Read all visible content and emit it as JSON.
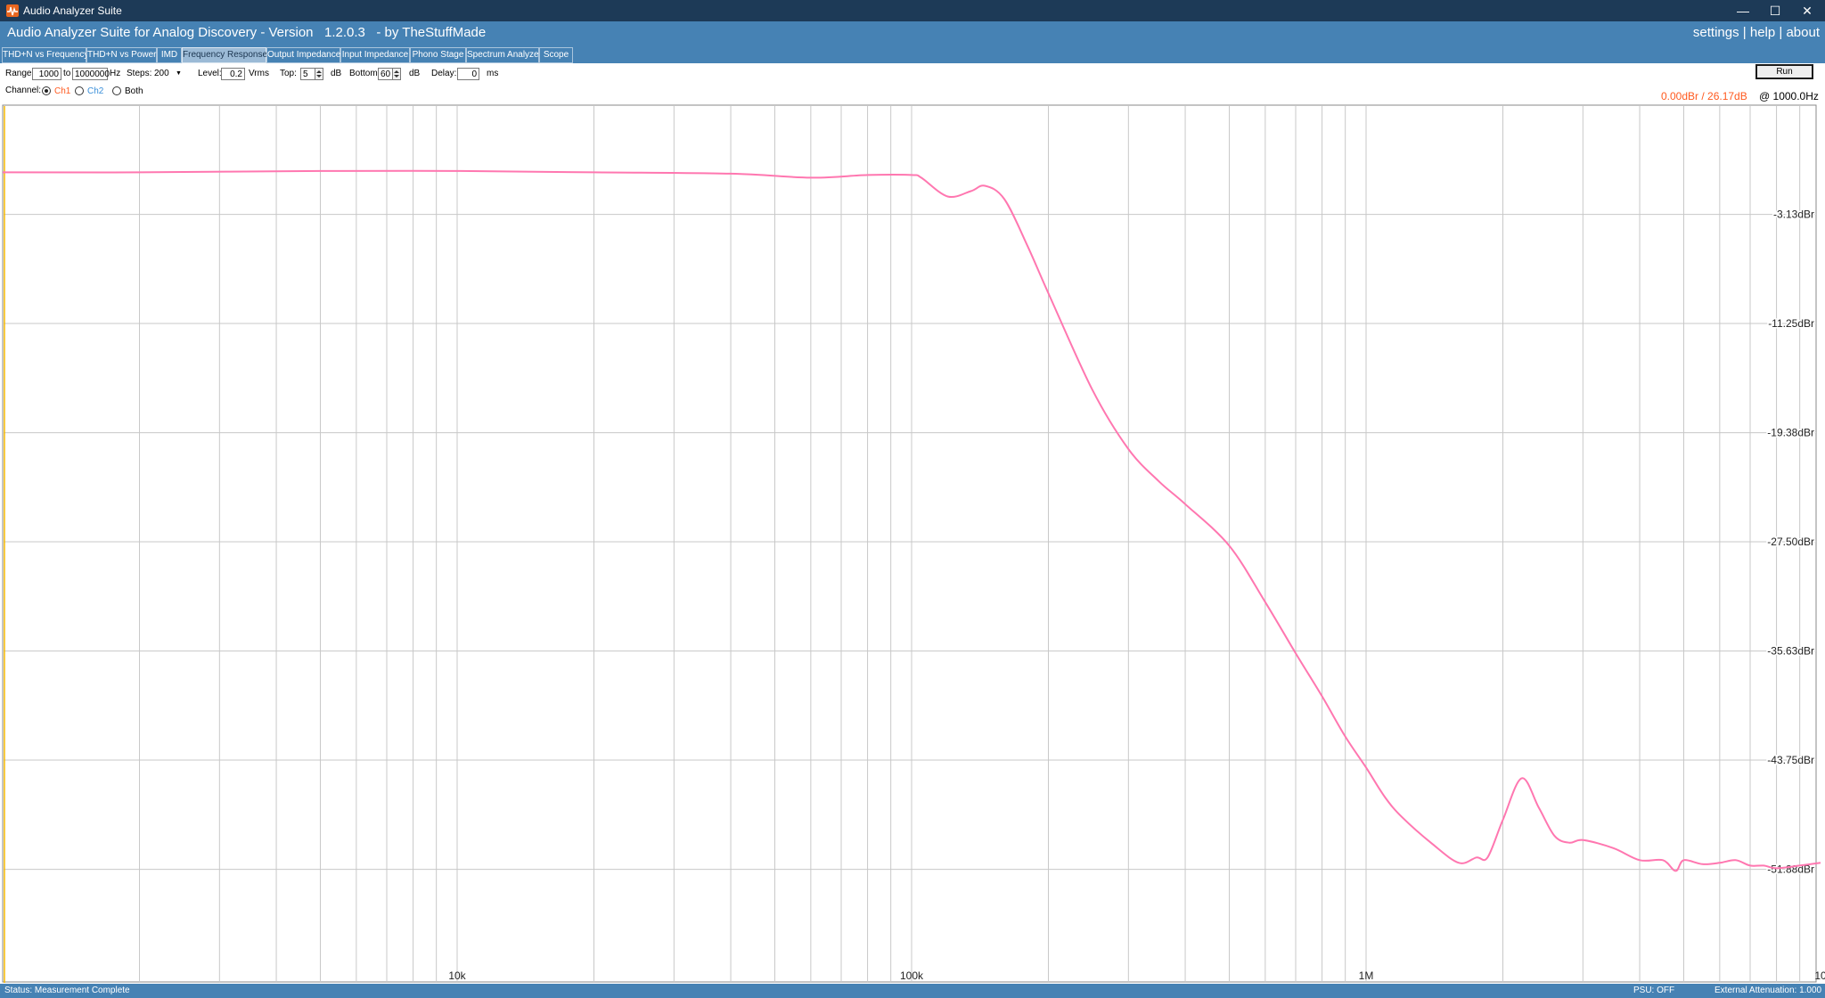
{
  "window": {
    "title": "Audio Analyzer Suite",
    "minimize_glyph": "—",
    "maximize_glyph": "☐",
    "close_glyph": "✕"
  },
  "header": {
    "title": "Audio Analyzer Suite for Analog Discovery - Version   1.2.0.3   - by TheStuffMade",
    "links": [
      "settings",
      "help",
      "about"
    ],
    "separator": " | "
  },
  "tabs": [
    {
      "label": "THD+N vs Frequency",
      "active": false
    },
    {
      "label": "THD+N vs Power",
      "active": false
    },
    {
      "label": "IMD",
      "active": false
    },
    {
      "label": "Frequency Response",
      "active": true
    },
    {
      "label": "Output Impedance",
      "active": false
    },
    {
      "label": "Input Impedance",
      "active": false
    },
    {
      "label": "Phono Stage",
      "active": false
    },
    {
      "label": "Spectrum Analyzer",
      "active": false
    },
    {
      "label": "Scope",
      "active": false
    }
  ],
  "controls": {
    "range_label": "Range:",
    "range_from": "1000",
    "to_label": "to",
    "range_to": "1000000",
    "hz_label": "Hz",
    "steps_label": "Steps:",
    "steps_value": "200",
    "level_label": "Level:",
    "level_value": "0.2",
    "level_unit": "Vrms",
    "top_label": "Top:",
    "top_value": "5",
    "top_unit": "dB",
    "bottom_label": "Bottom:",
    "bottom_value": "60",
    "bottom_unit": "dB",
    "delay_label": "Delay:",
    "delay_value": "0",
    "delay_unit": "ms",
    "channel_label": "Channel:",
    "channels": [
      {
        "label": "Ch1",
        "selected": true,
        "color": "#ff5a1f"
      },
      {
        "label": "Ch2",
        "selected": false,
        "color": "#3a8fd9"
      },
      {
        "label": "Both",
        "selected": false,
        "color": "#000000"
      }
    ],
    "run_label": "Run"
  },
  "readout": {
    "values": "0.00dBr / 26.17dB",
    "frequency": "@ 1000.0Hz",
    "values_color": "#ff5a1f"
  },
  "status": {
    "left": "Status: Measurement Complete",
    "psu": "PSU: OFF",
    "attenuation": "External Attenuation: 1.000"
  },
  "colors": {
    "titlebar": "#1d3a57",
    "accent": "#4682b4",
    "trace": "#ff77b0",
    "grid": "#c8c8c8",
    "cursor": "#f5b800"
  },
  "chart_data": {
    "type": "line",
    "x_scale": "log",
    "xlim": [
      1000,
      1000000
    ],
    "x_ticks": [
      {
        "value": 10000,
        "label": "10k"
      },
      {
        "value": 100000,
        "label": "100k"
      },
      {
        "value": 1000000,
        "label": "1M"
      },
      {
        "value": 10000000,
        "label": "10"
      }
    ],
    "ylim": [
      5,
      -60
    ],
    "y_ticks": [
      {
        "value": -3.13,
        "label": "-3.13dBr"
      },
      {
        "value": -11.25,
        "label": "-11.25dBr"
      },
      {
        "value": -19.38,
        "label": "-19.38dBr"
      },
      {
        "value": -27.5,
        "label": "-27.50dBr"
      },
      {
        "value": -35.63,
        "label": "-35.63dBr"
      },
      {
        "value": -43.75,
        "label": "-43.75dBr"
      },
      {
        "value": -51.88,
        "label": "-51.88dBr"
      }
    ],
    "grid": true,
    "cursor_x": 1000,
    "series": [
      {
        "color": "#ff77b0",
        "x": [
          1000,
          2000,
          5000,
          10000,
          20000,
          40000,
          60000,
          80000,
          100000,
          105000,
          120000,
          135000,
          145000,
          160000,
          180000,
          200000,
          250000,
          300000,
          350000,
          400000,
          500000,
          600000,
          700000,
          800000,
          900000,
          1000000,
          1100000,
          1200000,
          1400000,
          1600000,
          1750000,
          1850000,
          2000000,
          2200000,
          2400000,
          2600000,
          2800000,
          3000000,
          3500000,
          4000000,
          4500000,
          4800000,
          5000000,
          5500000,
          6000000,
          6500000,
          7000000,
          7500000,
          8000000,
          9000000,
          10000000
        ],
        "y": [
          0.0,
          0.0,
          0.1,
          0.1,
          0.0,
          -0.1,
          -0.4,
          -0.2,
          -0.2,
          -0.4,
          -1.8,
          -1.4,
          -1.0,
          -2.0,
          -5.5,
          -9.0,
          -16.2,
          -20.6,
          -23.0,
          -24.7,
          -27.8,
          -32.0,
          -35.8,
          -39.0,
          -42.0,
          -44.3,
          -46.5,
          -48.0,
          -50.0,
          -51.4,
          -51.0,
          -51.0,
          -48.2,
          -45.1,
          -47.3,
          -49.4,
          -49.9,
          -49.7,
          -50.3,
          -51.2,
          -51.2,
          -52.0,
          -51.2,
          -51.5,
          -51.4,
          -51.2,
          -51.6,
          -51.6,
          -51.8,
          -51.6,
          -51.4
        ]
      }
    ]
  }
}
